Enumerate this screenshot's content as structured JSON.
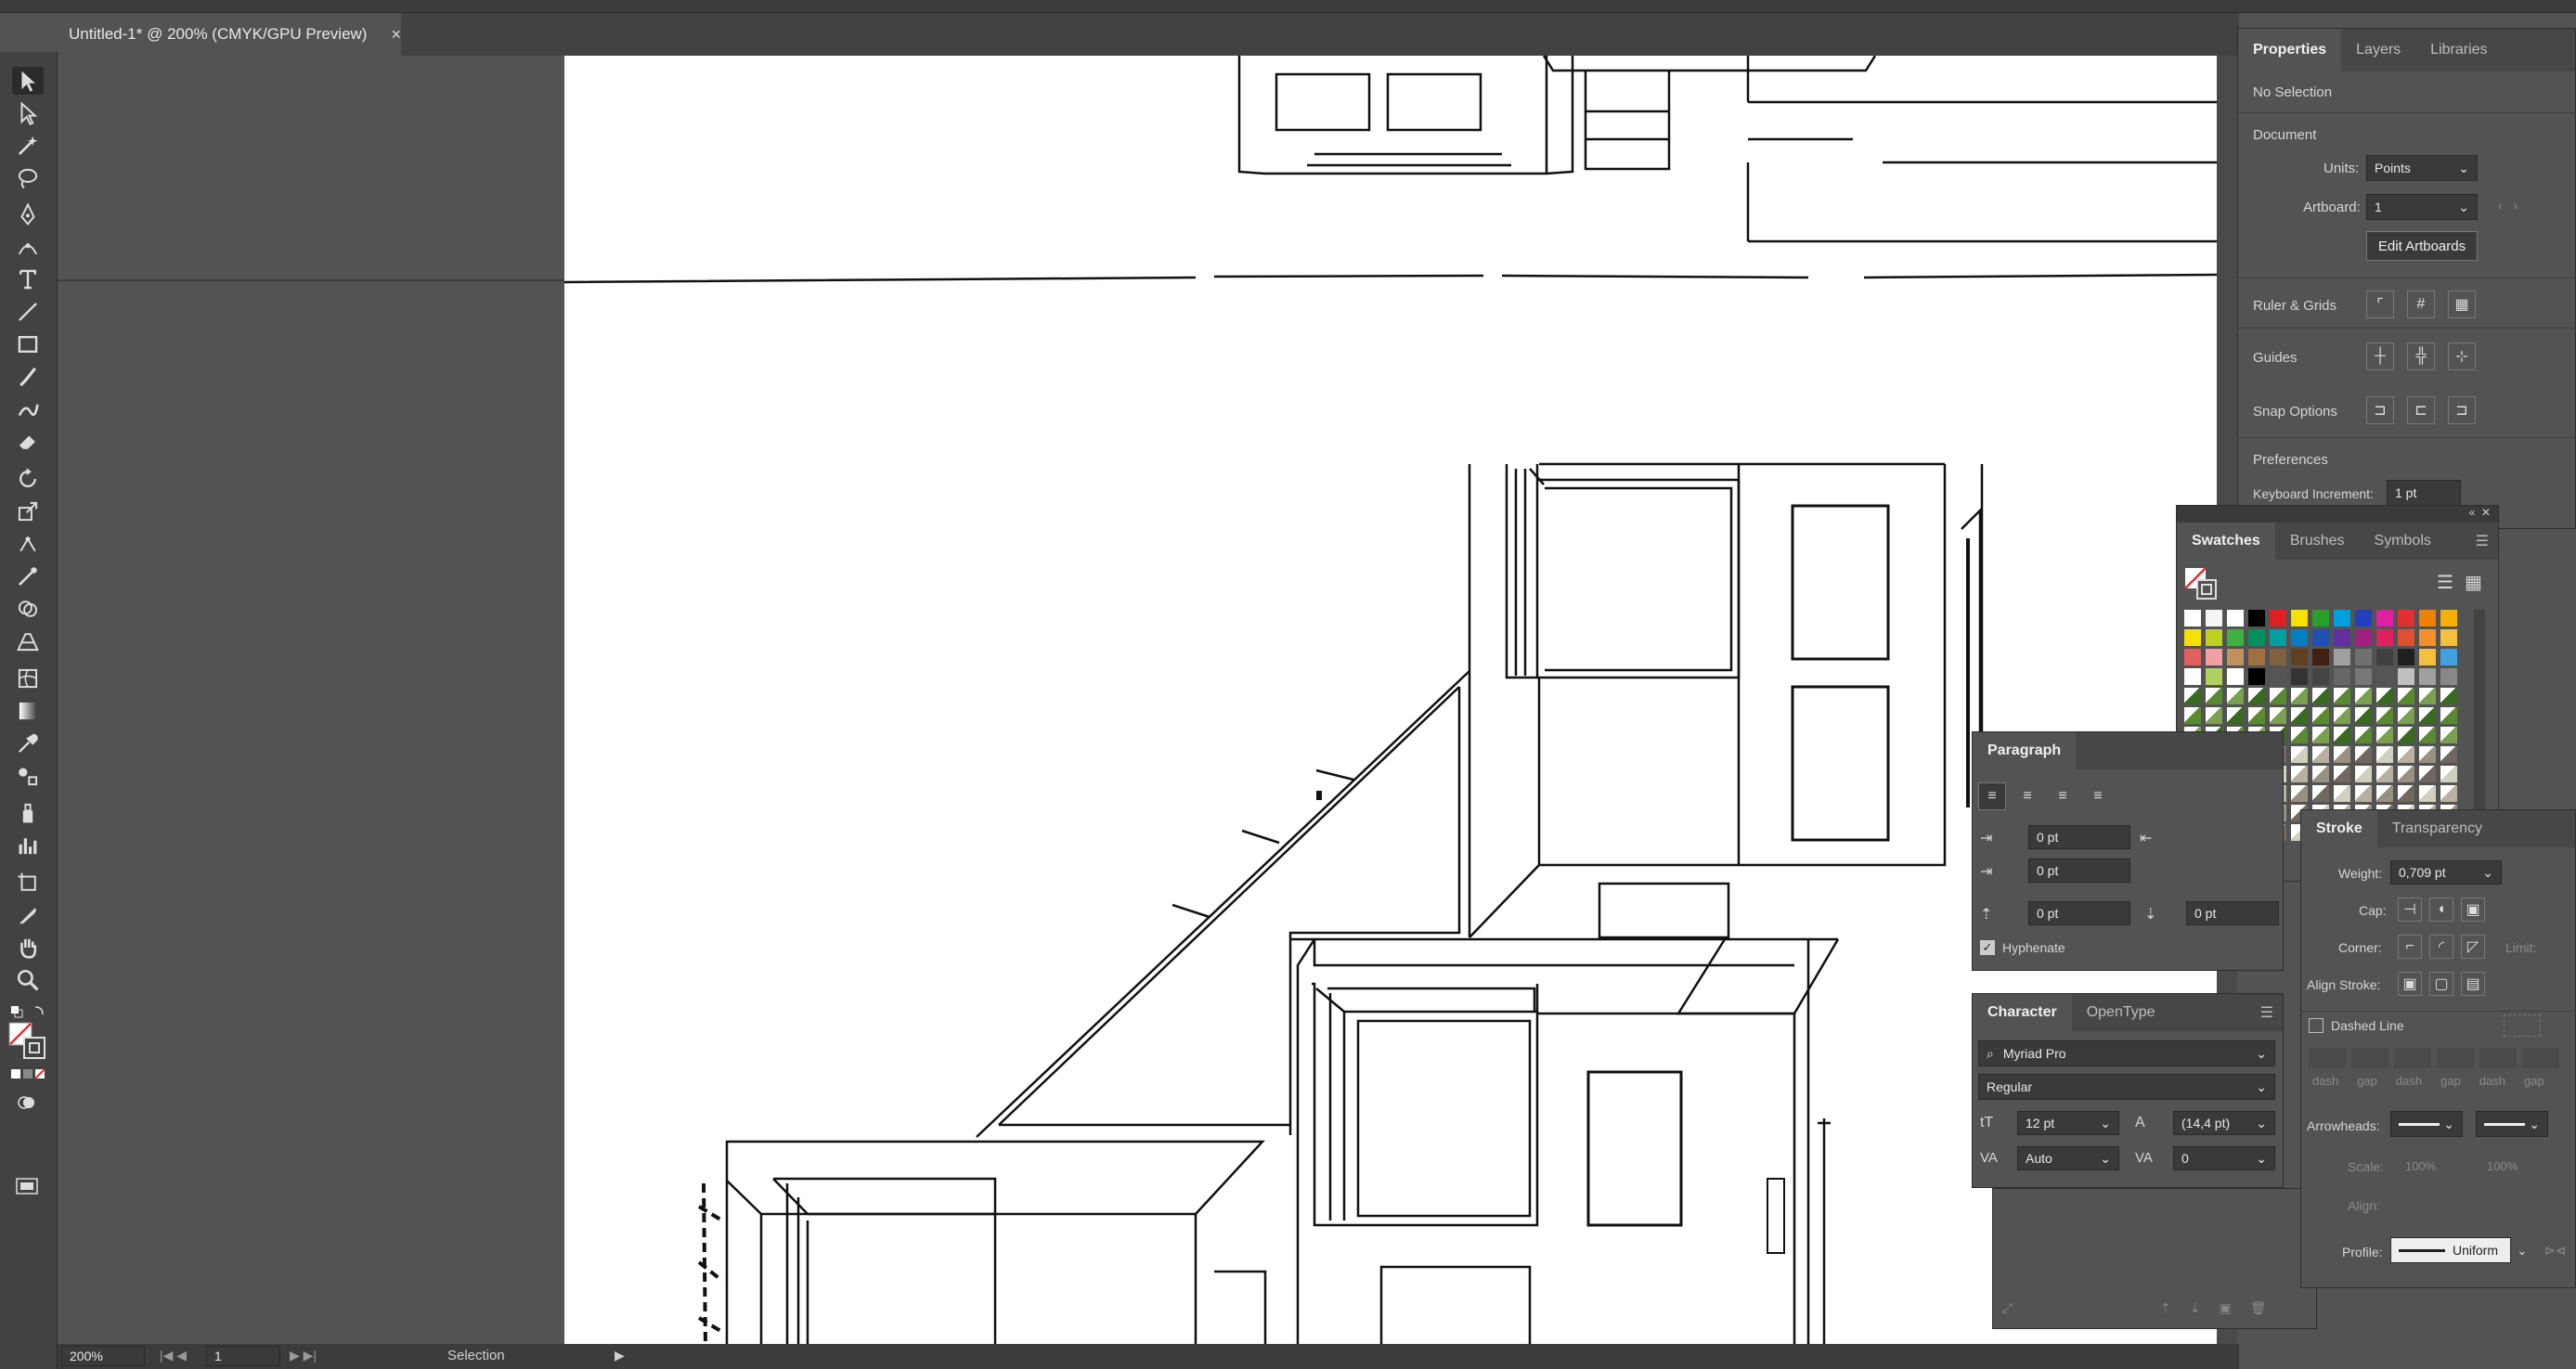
{
  "document_tab": {
    "title": "Untitled-1* @ 200% (CMYK/GPU Preview)",
    "close": "×"
  },
  "status": {
    "zoom": "200%",
    "artboard": "1",
    "tool": "Selection"
  },
  "properties": {
    "tabs": [
      "Properties",
      "Layers",
      "Libraries"
    ],
    "no_selection": "No Selection",
    "document": "Document",
    "units_label": "Units:",
    "units_value": "Points",
    "artboard_label": "Artboard:",
    "artboard_value": "1",
    "edit_artboards": "Edit Artboards",
    "ruler_grids": "Ruler & Grids",
    "guides": "Guides",
    "snap_options": "Snap Options",
    "preferences": "Preferences",
    "keyboard_increment_label": "Keyboard Increment:",
    "keyboard_increment_value": "1 pt"
  },
  "swatches": {
    "tabs": [
      "Swatches",
      "Brushes",
      "Symbols"
    ]
  },
  "paragraph": {
    "title": "Paragraph",
    "left_indent": "0 pt",
    "right_indent": "0 pt",
    "first_indent": "0 pt",
    "space_before": "0 pt",
    "space_after": "0 pt",
    "hyphenate": "Hyphenate"
  },
  "character": {
    "tabs": [
      "Character",
      "OpenType"
    ],
    "font": "Myriad Pro",
    "style": "Regular",
    "size": "12 pt",
    "leading": "(14,4 pt)",
    "kerning": "Auto",
    "tracking": "0"
  },
  "stroke": {
    "tabs": [
      "Stroke",
      "Transparency"
    ],
    "weight_label": "Weight:",
    "weight_value": "0,709 pt",
    "cap_label": "Cap:",
    "corner_label": "Corner:",
    "limit_label": "Limit:",
    "align_label": "Align Stroke:",
    "dashed_line": "Dashed Line",
    "dash_labels": [
      "dash",
      "gap",
      "dash",
      "gap",
      "dash",
      "gap"
    ],
    "arrowheads_label": "Arrowheads:",
    "scale_label": "Scale:",
    "scale_values": [
      "100%",
      "100%"
    ],
    "align2_label": "Align:",
    "profile_label": "Profile:",
    "profile_value": "Uniform"
  }
}
